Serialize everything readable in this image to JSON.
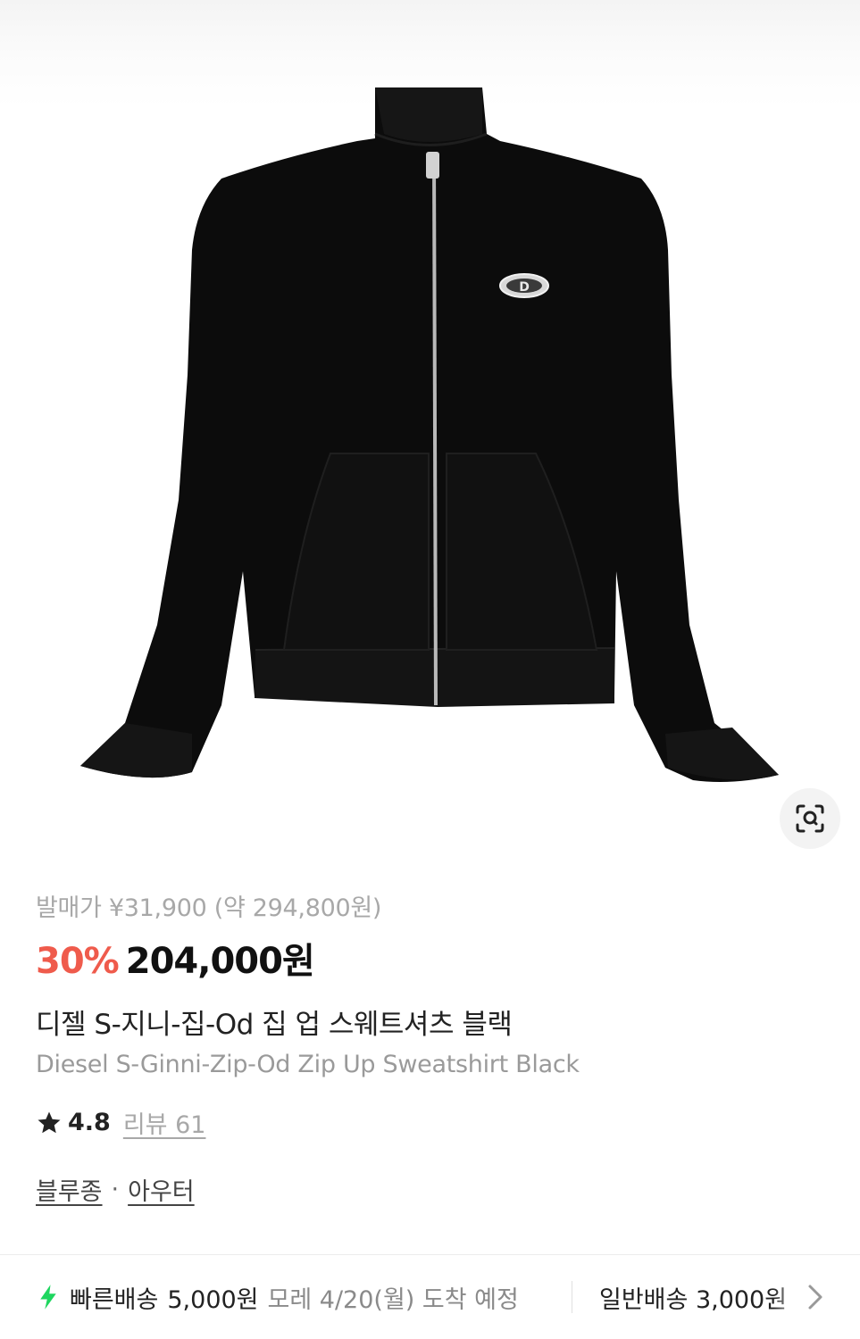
{
  "product": {
    "original_price": "발매가 ¥31,900 (약 294,800원)",
    "discount": "30%",
    "price": "204,000원",
    "name_ko": "디젤 S-지니-집-Od 집 업 스웨트셔츠 블랙",
    "name_en": "Diesel S-Ginni-Zip-Od Zip Up Sweatshirt Black",
    "rating": "4.8",
    "review_label": "리뷰 61",
    "categories": [
      "블루종",
      "아우터"
    ],
    "category_sep": "·"
  },
  "shipping": {
    "fast_label": "빠른배송",
    "fast_fee": "5,000원",
    "fast_eta": "모레 4/20(월) 도착 예정",
    "normal_label": "일반배송 3,000원"
  },
  "icons": {
    "lens": "lens-search-icon",
    "star": "star-icon",
    "bolt": "lightning-bolt-icon",
    "chevron": "chevron-right-icon"
  },
  "colors": {
    "discount": "#ef5b4c",
    "bolt": "#1ed65f",
    "muted": "#a8a8a8"
  }
}
